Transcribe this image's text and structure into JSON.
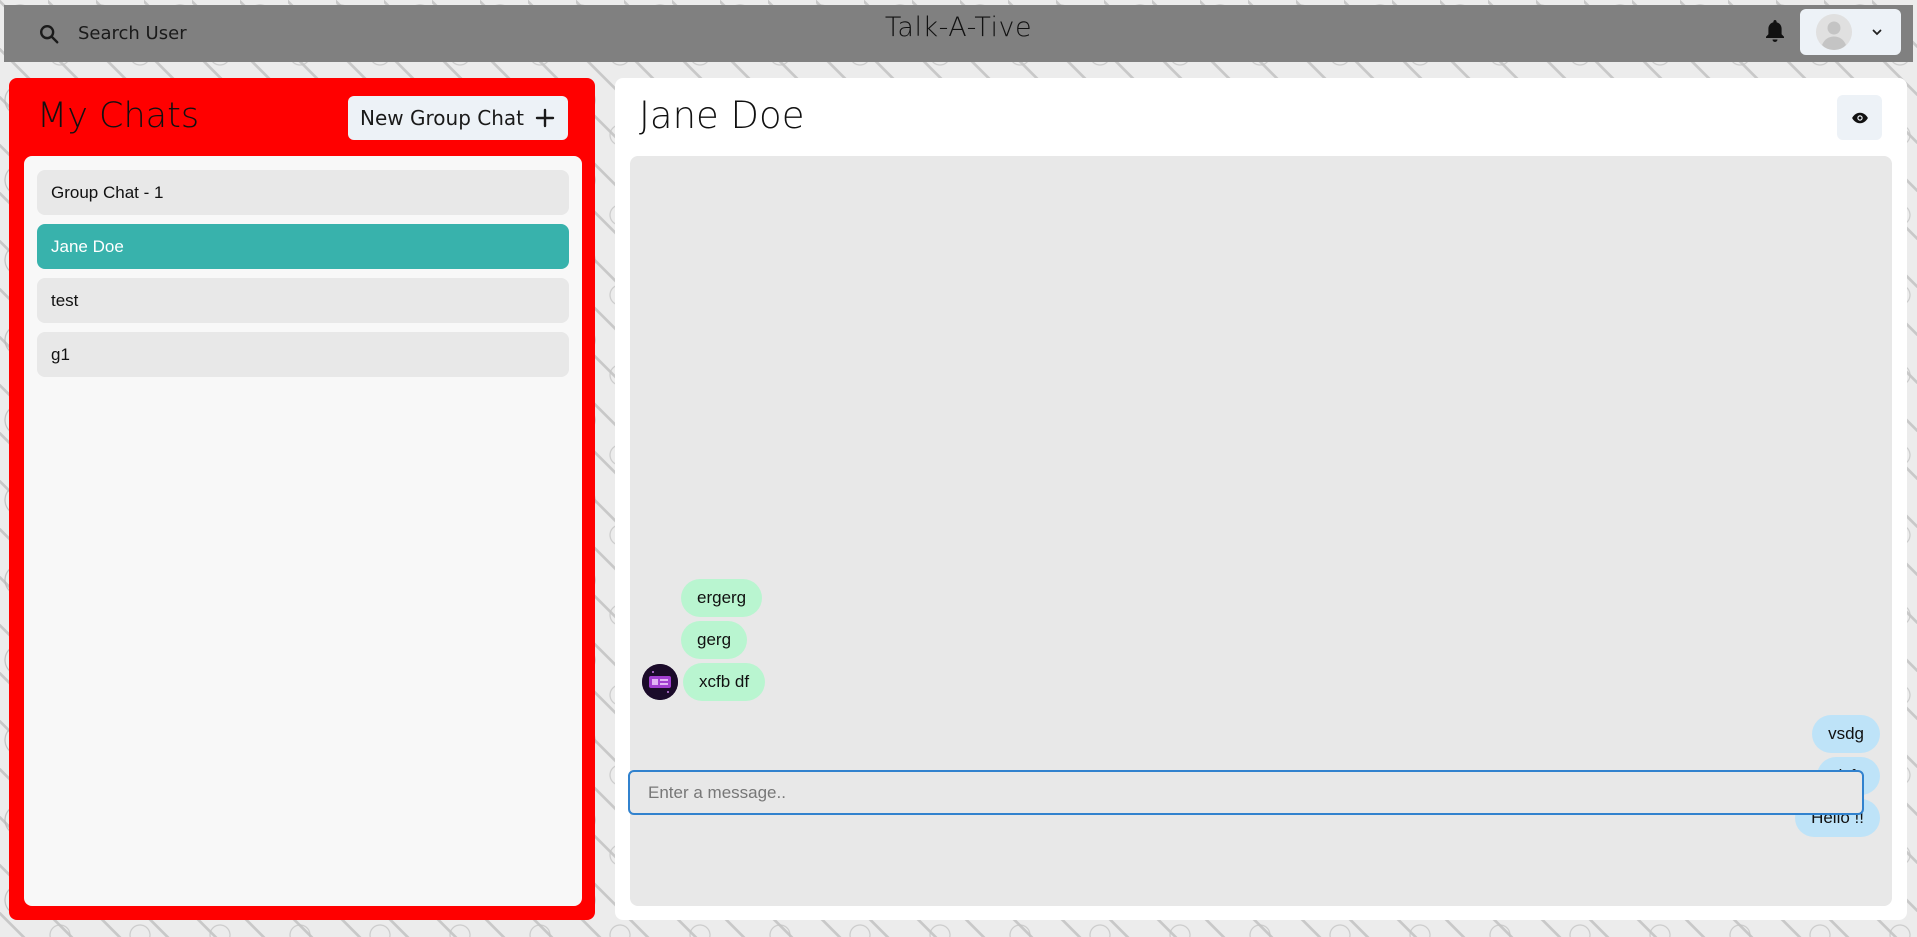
{
  "header": {
    "search_label": "Search User",
    "app_title": "Talk-A-Tive",
    "icons": {
      "search": "search-icon",
      "bell": "bell-icon",
      "avatar": "avatar-icon",
      "chevron": "chevron-down-icon"
    }
  },
  "sidebar": {
    "title": "My Chats",
    "new_group_label": "New Group Chat",
    "chats": [
      {
        "name": "Group Chat - 1",
        "selected": false
      },
      {
        "name": "Jane Doe",
        "selected": true
      },
      {
        "name": "test",
        "selected": false
      },
      {
        "name": "g1",
        "selected": false
      }
    ]
  },
  "chat": {
    "name": "Jane Doe",
    "messages": [
      {
        "text": "ergerg",
        "from": "other"
      },
      {
        "text": "gerg",
        "from": "other"
      },
      {
        "text": "xcfb df",
        "from": "other"
      },
      {
        "text": "vsdg",
        "from": "me"
      },
      {
        "text": "dsfs",
        "from": "me"
      },
      {
        "text": "Hello !!",
        "from": "me"
      }
    ],
    "input_placeholder": "Enter a message..",
    "input_value": ""
  },
  "colors": {
    "topbar": "#808080",
    "sidebar_bg": "#ff0000",
    "selected_chat": "#38b2ac",
    "received_bubble": "#b9f5d0",
    "sent_bubble": "#bee3f8",
    "input_border": "#3182ce"
  }
}
